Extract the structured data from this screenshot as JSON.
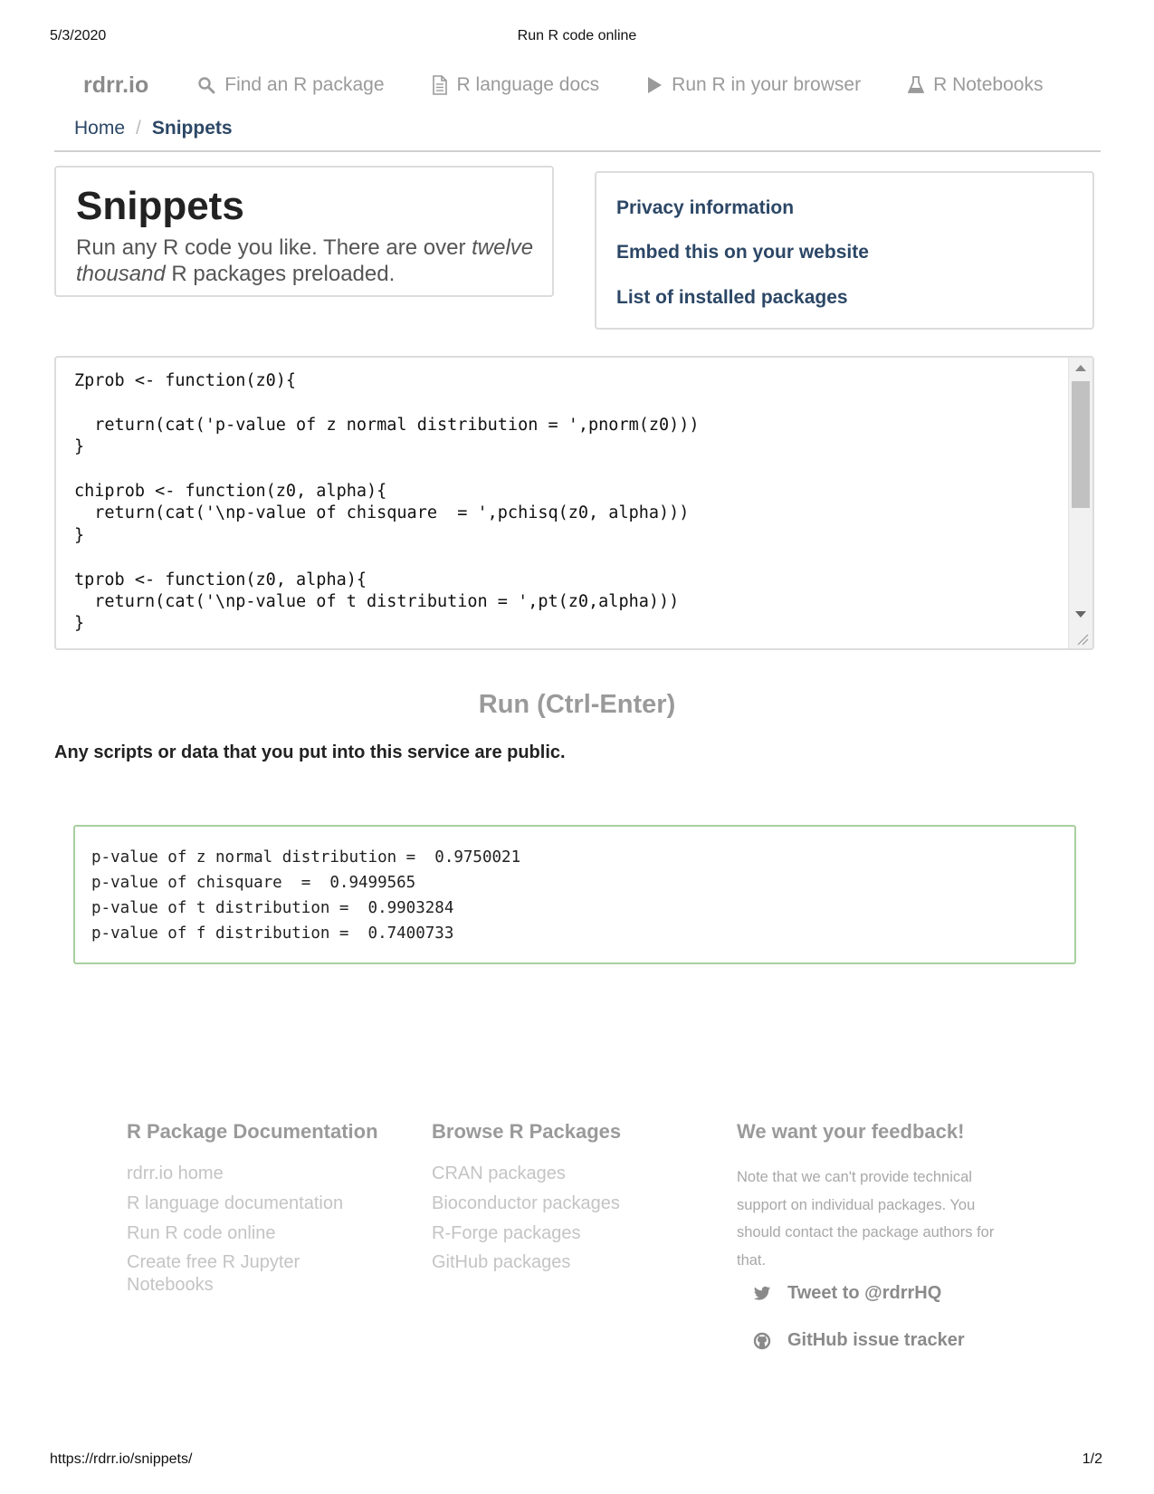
{
  "print": {
    "date": "5/3/2020",
    "title": "Run R code online",
    "url": "https://rdrr.io/snippets/",
    "page": "1/2"
  },
  "nav": {
    "brand": "rdrr.io",
    "links": [
      {
        "label": "Find an R package",
        "icon": "search-icon"
      },
      {
        "label": "R language docs",
        "icon": "document-icon"
      },
      {
        "label": "Run R in your browser",
        "icon": "play-icon"
      },
      {
        "label": "R Notebooks",
        "icon": "flask-icon"
      }
    ]
  },
  "breadcrumb": {
    "home": "Home",
    "separator": "/",
    "current": "Snippets"
  },
  "jumbotron": {
    "title": "Snippets",
    "lead_before": "Run any R code you like. There are over ",
    "lead_emphasis": "twelve thousand",
    "lead_after": " R packages preloaded."
  },
  "side_links": [
    "Privacy information",
    "Embed this on your website",
    "List of installed packages"
  ],
  "editor": {
    "code": "Zprob <- function(z0){\n\n  return(cat('p-value of z normal distribution = ',pnorm(z0)))\n}\n\nchiprob <- function(z0, alpha){\n  return(cat('\\np-value of chisquare  = ',pchisq(z0, alpha)))\n}\n\ntprob <- function(z0, alpha){\n  return(cat('\\np-value of t distribution = ',pt(z0,alpha)))\n}"
  },
  "run_button": "Run (Ctrl-Enter)",
  "public_note": "Any scripts or data that you put into this service are public.",
  "output_lines": [
    "p-value of z normal distribution =  0.9750021",
    "p-value of chisquare  =  0.9499565",
    "p-value of t distribution =  0.9903284",
    "p-value of f distribution =  0.7400733"
  ],
  "footer": {
    "docs": {
      "heading": "R Package Documentation",
      "links": [
        "rdrr.io home",
        "R language documentation",
        "Run R code online",
        "Create free R Jupyter Notebooks"
      ]
    },
    "browse": {
      "heading": "Browse R Packages",
      "links": [
        "CRAN packages",
        "Bioconductor packages",
        "R-Forge packages",
        "GitHub packages"
      ]
    },
    "feedback": {
      "heading": "We want your feedback!",
      "text": "Note that we can't provide technical support on individual packages. You should contact the package authors for that.",
      "twitter": "Tweet to @rdrrHQ",
      "github": "GitHub issue tracker"
    }
  }
}
